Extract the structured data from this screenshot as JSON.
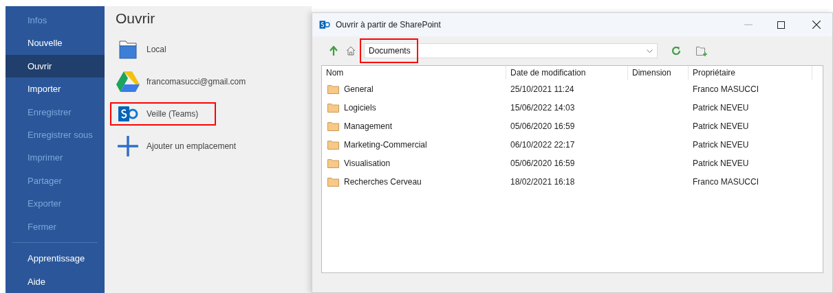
{
  "sidebar": {
    "items": [
      {
        "label": "Infos",
        "selected": false,
        "disabled": true
      },
      {
        "label": "Nouvelle",
        "selected": false,
        "disabled": false
      },
      {
        "label": "Ouvrir",
        "selected": true,
        "disabled": false
      },
      {
        "label": "Importer",
        "selected": false,
        "disabled": false
      },
      {
        "label": "Enregistrer",
        "selected": false,
        "disabled": true
      },
      {
        "label": "Enregistrer sous",
        "selected": false,
        "disabled": true
      },
      {
        "label": "Imprimer",
        "selected": false,
        "disabled": true
      },
      {
        "label": "Partager",
        "selected": false,
        "disabled": true
      },
      {
        "label": "Exporter",
        "selected": false,
        "disabled": true
      },
      {
        "label": "Fermer",
        "selected": false,
        "disabled": true
      }
    ],
    "bottom_items": [
      {
        "label": "Apprentissage",
        "selected": false,
        "disabled": false
      },
      {
        "label": "Aide",
        "selected": false,
        "disabled": false
      }
    ]
  },
  "page": {
    "title": "Ouvrir",
    "locations": [
      {
        "kind": "folder",
        "label": "Local",
        "highlighted": false
      },
      {
        "kind": "drive",
        "label": "francomasucci@gmail.com",
        "highlighted": false
      },
      {
        "kind": "sharepoint",
        "label": "Veille (Teams)",
        "highlighted": true
      },
      {
        "kind": "add",
        "label": "Ajouter un emplacement",
        "highlighted": false
      }
    ]
  },
  "dialog": {
    "title": "Ouvrir à partir de SharePoint",
    "path": {
      "value": "Documents",
      "highlighted": true
    },
    "columns": [
      "Nom",
      "Date de modification",
      "Dimension",
      "Propriétaire"
    ],
    "rows": [
      {
        "name": "General",
        "modified": "25/10/2021 11:24",
        "owner": "Franco MASUCCI"
      },
      {
        "name": "Logiciels",
        "modified": "15/06/2022 14:03",
        "owner": "Patrick NEVEU"
      },
      {
        "name": "Management",
        "modified": "05/06/2020 16:59",
        "owner": "Patrick NEVEU"
      },
      {
        "name": "Marketing-Commercial",
        "modified": "06/10/2022 22:17",
        "owner": "Patrick NEVEU"
      },
      {
        "name": "Visualisation",
        "modified": "05/06/2020 16:59",
        "owner": "Patrick NEVEU"
      },
      {
        "name": "Recherches Cerveau",
        "modified": "18/02/2021 16:18",
        "owner": "Franco MASUCCI"
      }
    ]
  }
}
